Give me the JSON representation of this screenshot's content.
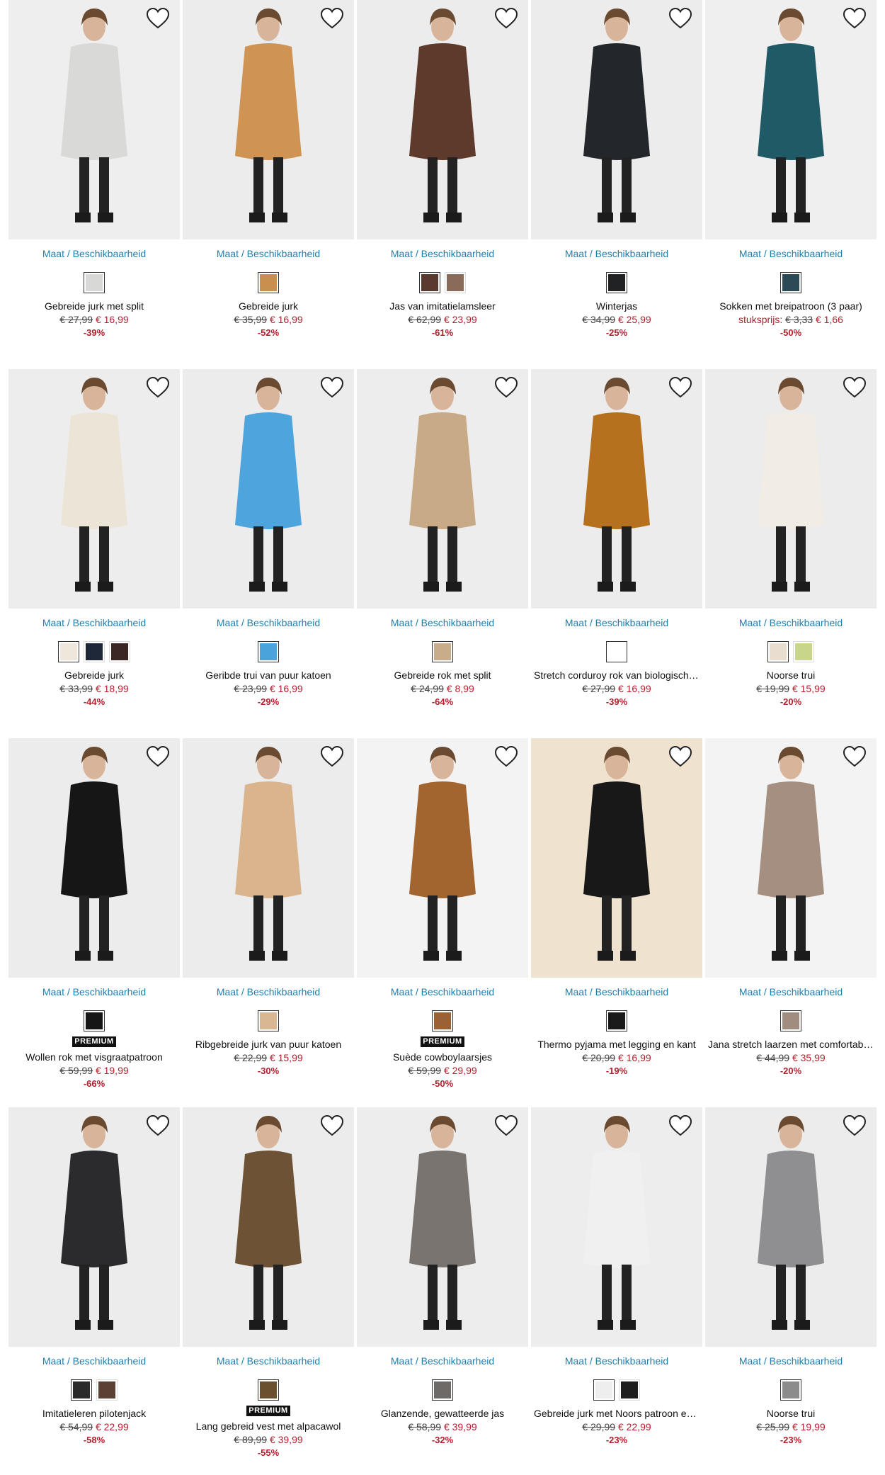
{
  "availability_label": "Maat / Beschikbaarheid",
  "favorite_icon": "heart-outline-icon",
  "colors": {
    "link": "#1f7fae",
    "sale": "#b2202e",
    "badge_bg": "#111111"
  },
  "products": [
    {
      "name": "Gebreide jurk met split",
      "old_price": "€ 27,99",
      "new_price": "€ 16,99",
      "discount": "-39%",
      "premium": false,
      "unit_label": "",
      "swatches": [
        "#d8d8d6"
      ],
      "bg": "#eeeeee",
      "item": "#d9d9d7"
    },
    {
      "name": "Gebreide jurk",
      "old_price": "€ 35,99",
      "new_price": "€ 16,99",
      "discount": "-52%",
      "premium": false,
      "unit_label": "",
      "swatches": [
        "#c98f4e"
      ],
      "bg": "#ececec",
      "item": "#cf9454"
    },
    {
      "name": "Jas van imitatielamsleer",
      "old_price": "€ 62,99",
      "new_price": "€ 23,99",
      "discount": "-61%",
      "premium": false,
      "unit_label": "",
      "swatches": [
        "#5a3a2e",
        "#8a6a58"
      ],
      "bg": "#ececec",
      "item": "#5d3a2c"
    },
    {
      "name": "Winterjas",
      "old_price": "€ 34,99",
      "new_price": "€ 25,99",
      "discount": "-25%",
      "premium": false,
      "unit_label": "",
      "swatches": [
        "#202224"
      ],
      "bg": "#ececec",
      "item": "#23272b"
    },
    {
      "name": "Sokken met breipatroon (3 paar)",
      "old_price": "€ 3,33",
      "new_price": "€ 1,66",
      "discount": "-50%",
      "premium": false,
      "unit_label": "stuksprijs:",
      "swatches": [
        "#2c4a55"
      ],
      "bg": "#efefef",
      "item": "#1f5a66"
    },
    {
      "name": "Gebreide jurk",
      "old_price": "€ 33,99",
      "new_price": "€ 18,99",
      "discount": "-44%",
      "premium": false,
      "unit_label": "",
      "swatches": [
        "#efe7dc",
        "#1e2838",
        "#3b2623"
      ],
      "bg": "#ededed",
      "item": "#ece4d6"
    },
    {
      "name": "Geribde trui van puur katoen",
      "old_price": "€ 23,99",
      "new_price": "€ 16,99",
      "discount": "-29%",
      "premium": false,
      "unit_label": "",
      "swatches": [
        "#4aa3db"
      ],
      "bg": "#ececec",
      "item": "#4ea5dd"
    },
    {
      "name": "Gebreide rok met split",
      "old_price": "€ 24,99",
      "new_price": "€ 8,99",
      "discount": "-64%",
      "premium": false,
      "unit_label": "",
      "swatches": [
        "#c9ad8a"
      ],
      "bg": "#ededed",
      "item": "#c8ab86"
    },
    {
      "name": "Stretch corduroy rok van biologisch katoen",
      "old_price": "€ 27,99",
      "new_price": "€ 16,99",
      "discount": "-39%",
      "premium": false,
      "unit_label": "",
      "swatches": [
        "#ffffff"
      ],
      "bg": "#ececec",
      "item": "#b5711e"
    },
    {
      "name": "Noorse trui",
      "old_price": "€ 19,99",
      "new_price": "€ 15,99",
      "discount": "-20%",
      "premium": false,
      "unit_label": "",
      "swatches": [
        "#e9ddd0",
        "#c8d68a"
      ],
      "bg": "#ececec",
      "item": "#f1ece4"
    },
    {
      "name": "Wollen rok met visgraatpatroon",
      "old_price": "€ 59,99",
      "new_price": "€ 19,99",
      "discount": "-66%",
      "premium": true,
      "premium_label": "PREMIUM",
      "unit_label": "",
      "swatches": [
        "#151515"
      ],
      "bg": "#ececec",
      "item": "#161616"
    },
    {
      "name": "Ribgebreide jurk van puur katoen",
      "old_price": "€ 22,99",
      "new_price": "€ 15,99",
      "discount": "-30%",
      "premium": false,
      "unit_label": "",
      "swatches": [
        "#d8b792"
      ],
      "bg": "#ececec",
      "item": "#d9b48c"
    },
    {
      "name": "Suède cowboylaarsjes",
      "old_price": "€ 59,99",
      "new_price": "€ 29,99",
      "discount": "-50%",
      "premium": true,
      "premium_label": "PREMIUM",
      "unit_label": "",
      "swatches": [
        "#9a6234"
      ],
      "bg": "#f3f3f3",
      "item": "#a2652f"
    },
    {
      "name": "Thermo pyjama met legging en kant",
      "old_price": "€ 20,99",
      "new_price": "€ 16,99",
      "discount": "-19%",
      "premium": false,
      "unit_label": "",
      "swatches": [
        "#1a1a1a"
      ],
      "bg": "#efe3cf",
      "item": "#181818"
    },
    {
      "name": "Jana stretch laarzen met comfortabele hak",
      "old_price": "€ 44,99",
      "new_price": "€ 35,99",
      "discount": "-20%",
      "premium": false,
      "unit_label": "",
      "swatches": [
        "#a08d80"
      ],
      "bg": "#f3f3f3",
      "item": "#a48f80"
    },
    {
      "name": "Imitatieleren pilotenjack",
      "old_price": "€ 54,99",
      "new_price": "€ 22,99",
      "discount": "-58%",
      "premium": false,
      "unit_label": "",
      "swatches": [
        "#2a2a2a",
        "#5b4033"
      ],
      "bg": "#ececec",
      "item": "#2b2b2d"
    },
    {
      "name": "Lang gebreid vest met alpacawol",
      "old_price": "€ 89,99",
      "new_price": "€ 39,99",
      "discount": "-55%",
      "premium": true,
      "premium_label": "PREMIUM",
      "unit_label": "",
      "swatches": [
        "#6b5030"
      ],
      "bg": "#ececec",
      "item": "#6e5236"
    },
    {
      "name": "Glanzende, gewatteerde jas",
      "old_price": "€ 58,99",
      "new_price": "€ 39,99",
      "discount": "-32%",
      "premium": false,
      "unit_label": "",
      "swatches": [
        "#6d6a68"
      ],
      "bg": "#ededed",
      "item": "#7a7470"
    },
    {
      "name": "Gebreide jurk met Noors patroon en split",
      "old_price": "€ 29,99",
      "new_price": "€ 22,99",
      "discount": "-23%",
      "premium": false,
      "unit_label": "",
      "swatches": [
        "#eeeeee",
        "#1e1e1e"
      ],
      "bg": "#ededed",
      "item": "#f0f0f0"
    },
    {
      "name": "Noorse trui",
      "old_price": "€ 25,99",
      "new_price": "€ 19,99",
      "discount": "-23%",
      "premium": false,
      "unit_label": "",
      "swatches": [
        "#8c8c8c"
      ],
      "bg": "#ececec",
      "item": "#8f8f92"
    }
  ]
}
